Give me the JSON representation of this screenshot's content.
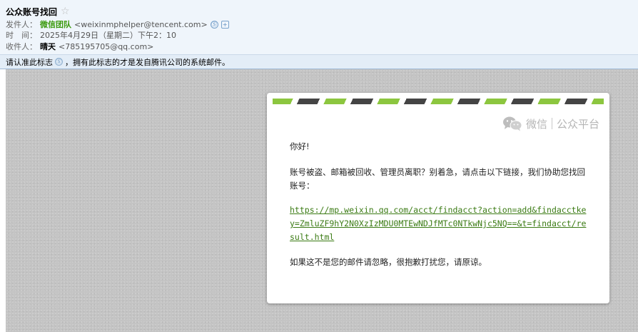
{
  "email": {
    "subject": "公众账号找回",
    "from_label": "发件人：",
    "from_name": "微信团队",
    "from_address": "<weixinmphelper@tencent.com>",
    "time_label": "时　间：",
    "time_value": "2025年4月29日（星期二）下午2：10",
    "to_label": "收件人：",
    "to_name": "晴天",
    "to_address": "<785195705@qq.com>"
  },
  "notice": {
    "part1": "请认准此标志",
    "part2": "，拥有此标志的才是发自腾讯公司的系统邮件。"
  },
  "card": {
    "brand_left": "微信",
    "brand_right": "公众平台",
    "greeting": "你好!",
    "main_text": "账号被盗、邮箱被回收、管理员离职？别着急，请点击以下链接，我们协助您找回账号：",
    "link": "https://mp.weixin.qq.com/acct/findacct?action=add&findacctkey=ZmluZF9hY2N0XzIzMDU0MTEwNDJfMTc0NTkwNjc5NQ==&t=findacct/result.html",
    "ignore_text": "如果这不是您的邮件请忽略，很抱歉打扰您，请原谅。"
  },
  "colors": {
    "accent_green": "#8cc63f",
    "stripe_dark": "#444444",
    "link_green": "#3b7b14",
    "header_bg": "#eff5fb"
  }
}
